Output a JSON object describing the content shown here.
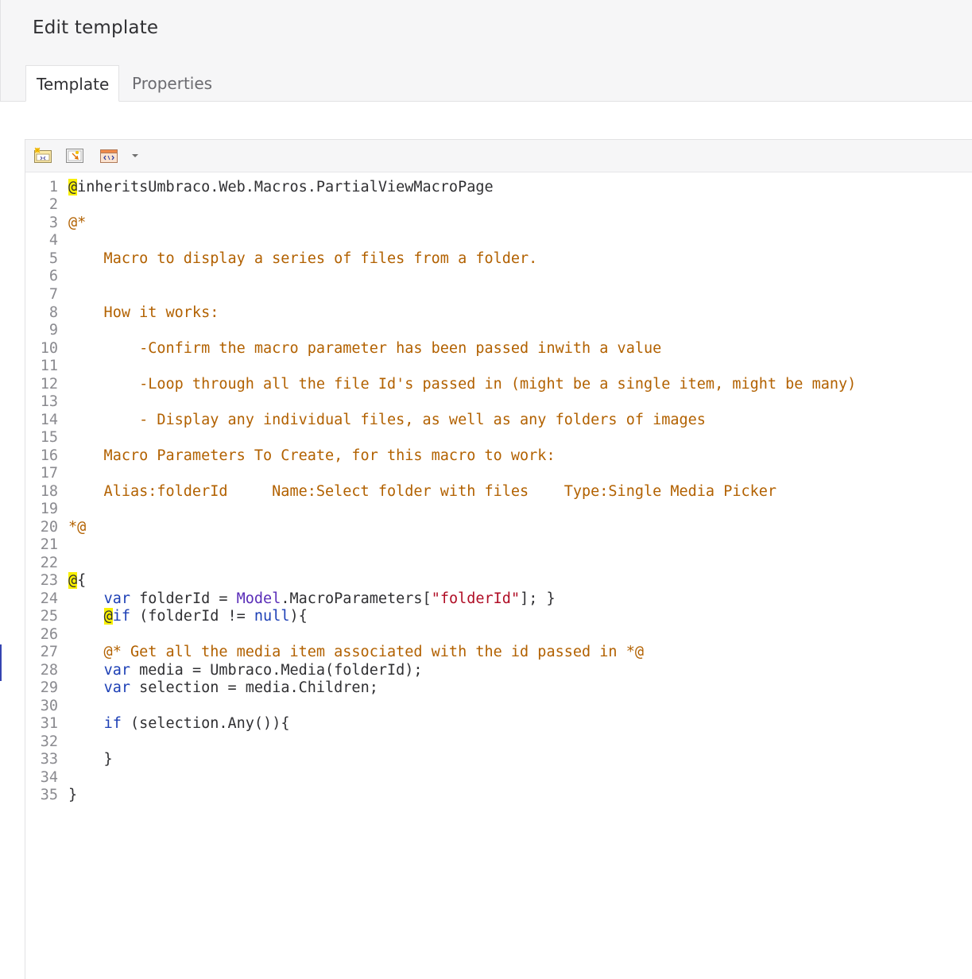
{
  "page": {
    "title": "Edit template"
  },
  "tabs": [
    {
      "label": "Template",
      "active": true
    },
    {
      "label": "Properties",
      "active": false
    }
  ],
  "toolbar": {
    "buttons": [
      {
        "icon": "insert-macro-icon"
      },
      {
        "icon": "insert-field-icon"
      },
      {
        "icon": "insert-section-icon"
      }
    ],
    "dropdown_icon": "chevron-down-icon"
  },
  "colors": {
    "comment": "#b26100",
    "keyword": "#1c3fb5",
    "type": "#5a2db8",
    "string": "#b00e26",
    "razor_highlight": "#f8f000"
  },
  "code_lines": [
    {
      "n": "1",
      "tokens": [
        {
          "t": "@",
          "c": "hl"
        },
        {
          "t": "inheritsUmbraco.Web.Macros.PartialViewMacroPage",
          "c": ""
        }
      ]
    },
    {
      "n": "2",
      "tokens": []
    },
    {
      "n": "3",
      "tokens": [
        {
          "t": "@*",
          "c": "cm"
        }
      ]
    },
    {
      "n": "4",
      "tokens": []
    },
    {
      "n": "5",
      "tokens": [
        {
          "t": "    Macro to display a series of files from a folder.",
          "c": "cm"
        }
      ]
    },
    {
      "n": "6",
      "tokens": []
    },
    {
      "n": "7",
      "tokens": []
    },
    {
      "n": "8",
      "tokens": [
        {
          "t": "    How it works:",
          "c": "cm"
        }
      ]
    },
    {
      "n": "9",
      "tokens": []
    },
    {
      "n": "10",
      "tokens": [
        {
          "t": "        -Confirm the macro parameter has been passed inwith a value",
          "c": "cm"
        }
      ]
    },
    {
      "n": "11",
      "tokens": []
    },
    {
      "n": "12",
      "tokens": [
        {
          "t": "        -Loop through all the file Id's passed in (might be a single item, might be many)",
          "c": "cm"
        }
      ]
    },
    {
      "n": "13",
      "tokens": []
    },
    {
      "n": "14",
      "tokens": [
        {
          "t": "        - Display any individual files, as well as any folders of images",
          "c": "cm"
        }
      ]
    },
    {
      "n": "15",
      "tokens": []
    },
    {
      "n": "16",
      "tokens": [
        {
          "t": "    Macro Parameters To Create, for this macro to work:",
          "c": "cm"
        }
      ]
    },
    {
      "n": "17",
      "tokens": []
    },
    {
      "n": "18",
      "tokens": [
        {
          "t": "    Alias:folderId     Name:Select folder with files    Type:Single Media Picker",
          "c": "cm"
        }
      ]
    },
    {
      "n": "19",
      "tokens": []
    },
    {
      "n": "20",
      "tokens": [
        {
          "t": "*@",
          "c": "cm"
        }
      ]
    },
    {
      "n": "21",
      "tokens": []
    },
    {
      "n": "22",
      "tokens": []
    },
    {
      "n": "23",
      "tokens": [
        {
          "t": "@",
          "c": "hl"
        },
        {
          "t": "{",
          "c": ""
        }
      ]
    },
    {
      "n": "24",
      "tokens": [
        {
          "t": "    ",
          "c": ""
        },
        {
          "t": "var",
          "c": "kw"
        },
        {
          "t": " folderId = ",
          "c": ""
        },
        {
          "t": "Model",
          "c": "tp"
        },
        {
          "t": ".MacroParameters[",
          "c": ""
        },
        {
          "t": "\"folderId\"",
          "c": "st"
        },
        {
          "t": "]; }",
          "c": ""
        }
      ]
    },
    {
      "n": "25",
      "tokens": [
        {
          "t": "    ",
          "c": ""
        },
        {
          "t": "@",
          "c": "hl"
        },
        {
          "t": "if",
          "c": "kw"
        },
        {
          "t": " (folderId != ",
          "c": ""
        },
        {
          "t": "null",
          "c": "kw"
        },
        {
          "t": "){",
          "c": ""
        }
      ]
    },
    {
      "n": "26",
      "tokens": []
    },
    {
      "n": "27",
      "tokens": [
        {
          "t": "    @* Get all the media item associated with the id passed in *@",
          "c": "cm"
        }
      ]
    },
    {
      "n": "28",
      "tokens": [
        {
          "t": "    ",
          "c": ""
        },
        {
          "t": "var",
          "c": "kw"
        },
        {
          "t": " media = Umbraco.Media(folderId);",
          "c": ""
        }
      ]
    },
    {
      "n": "29",
      "tokens": [
        {
          "t": "    ",
          "c": ""
        },
        {
          "t": "var",
          "c": "kw"
        },
        {
          "t": " selection = media.Children;",
          "c": ""
        }
      ]
    },
    {
      "n": "30",
      "tokens": []
    },
    {
      "n": "31",
      "tokens": [
        {
          "t": "    ",
          "c": ""
        },
        {
          "t": "if",
          "c": "kw"
        },
        {
          "t": " (selection.Any()){",
          "c": ""
        }
      ]
    },
    {
      "n": "32",
      "tokens": []
    },
    {
      "n": "33",
      "tokens": [
        {
          "t": "    }",
          "c": ""
        }
      ]
    },
    {
      "n": "34",
      "tokens": []
    },
    {
      "n": "35",
      "tokens": [
        {
          "t": "}",
          "c": ""
        }
      ]
    }
  ]
}
